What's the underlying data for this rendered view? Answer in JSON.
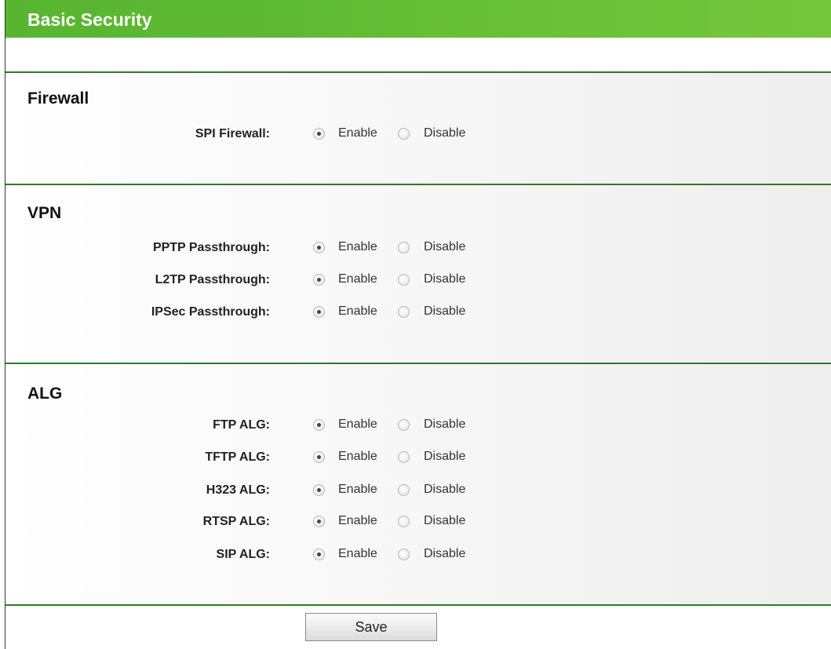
{
  "header": {
    "title": "Basic Security"
  },
  "options": {
    "enable_label": "Enable",
    "disable_label": "Disable"
  },
  "sections": {
    "firewall": {
      "title": "Firewall",
      "rows": [
        {
          "label": "SPI Firewall:",
          "value": "Enable"
        }
      ]
    },
    "vpn": {
      "title": "VPN",
      "rows": [
        {
          "label": "PPTP Passthrough:",
          "value": "Enable"
        },
        {
          "label": "L2TP Passthrough:",
          "value": "Enable"
        },
        {
          "label": "IPSec Passthrough:",
          "value": "Enable"
        }
      ]
    },
    "alg": {
      "title": "ALG",
      "rows": [
        {
          "label": "FTP ALG:",
          "value": "Enable"
        },
        {
          "label": "TFTP ALG:",
          "value": "Enable"
        },
        {
          "label": "H323 ALG:",
          "value": "Enable"
        },
        {
          "label": "RTSP ALG:",
          "value": "Enable"
        },
        {
          "label": "SIP ALG:",
          "value": "Enable"
        }
      ]
    }
  },
  "actions": {
    "save_label": "Save"
  },
  "colors": {
    "header_green": "#5fba33",
    "divider_green": "#2e7a2a"
  }
}
